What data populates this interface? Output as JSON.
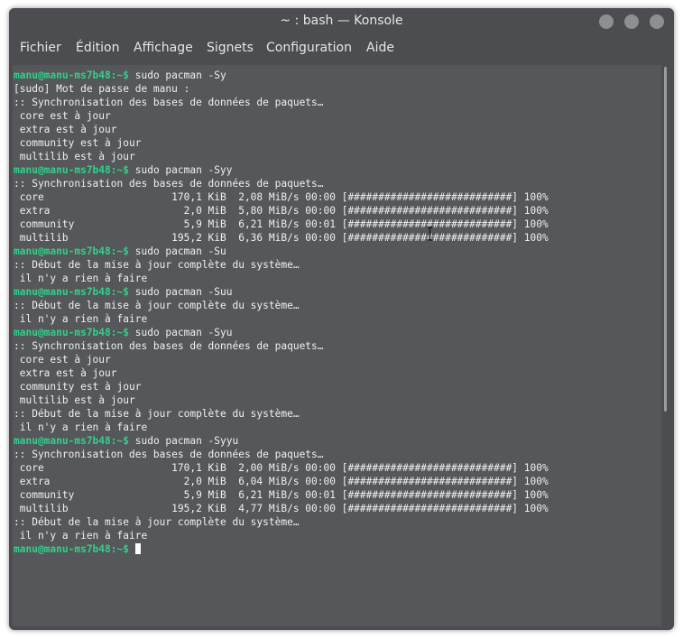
{
  "window": {
    "title": "~ : bash — Konsole",
    "controls": [
      "minimize-icon",
      "maximize-icon",
      "close-icon"
    ]
  },
  "menu": [
    "Fichier",
    "Édition",
    "Affichage",
    "Signets",
    "Configuration",
    "Aide"
  ],
  "terminal": {
    "prompt": "manu@manu-ms7b48",
    "colors": {
      "prompt": "#31d18b",
      "text": "#f0f0f0",
      "background": "#55575a"
    },
    "lines": [
      {
        "p": "manu@manu-ms7b48",
        "s": ":~$",
        "t": " sudo pacman -Sy"
      },
      {
        "t": "[sudo] Mot de passe de manu :"
      },
      {
        "t": ":: Synchronisation des bases de données de paquets…"
      },
      {
        "t": " core est à jour"
      },
      {
        "t": " extra est à jour"
      },
      {
        "t": " community est à jour"
      },
      {
        "t": " multilib est à jour"
      },
      {
        "p": "manu@manu-ms7b48",
        "s": ":~$",
        "t": " sudo pacman -Syy"
      },
      {
        "t": ":: Synchronisation des bases de données de paquets…"
      },
      {
        "t": " core                     170,1 KiB  2,08 MiB/s 00:00 [###########################] 100%"
      },
      {
        "t": " extra                      2,0 MiB  5,80 MiB/s 00:00 [###########################] 100%"
      },
      {
        "t": " community                  5,9 MiB  6,21 MiB/s 00:01 [###########################] 100%"
      },
      {
        "t": " multilib                 195,2 KiB  6,36 MiB/s 00:00 [###########################] 100%"
      },
      {
        "p": "manu@manu-ms7b48",
        "s": ":~$",
        "t": " sudo pacman -Su"
      },
      {
        "t": ":: Début de la mise à jour complète du système…"
      },
      {
        "t": " il n'y a rien à faire"
      },
      {
        "p": "manu@manu-ms7b48",
        "s": ":~$",
        "t": " sudo pacman -Suu"
      },
      {
        "t": ":: Début de la mise à jour complète du système…"
      },
      {
        "t": " il n'y a rien à faire"
      },
      {
        "p": "manu@manu-ms7b48",
        "s": ":~$",
        "t": " sudo pacman -Syu"
      },
      {
        "t": ":: Synchronisation des bases de données de paquets…"
      },
      {
        "t": " core est à jour"
      },
      {
        "t": " extra est à jour"
      },
      {
        "t": " community est à jour"
      },
      {
        "t": " multilib est à jour"
      },
      {
        "t": ":: Début de la mise à jour complète du système…"
      },
      {
        "t": " il n'y a rien à faire"
      },
      {
        "p": "manu@manu-ms7b48",
        "s": ":~$",
        "t": " sudo pacman -Syyu"
      },
      {
        "t": ":: Synchronisation des bases de données de paquets…"
      },
      {
        "t": " core                     170,1 KiB  2,00 MiB/s 00:00 [###########################] 100%"
      },
      {
        "t": " extra                      2,0 MiB  6,04 MiB/s 00:00 [###########################] 100%"
      },
      {
        "t": " community                  5,9 MiB  6,21 MiB/s 00:01 [###########################] 100%"
      },
      {
        "t": " multilib                 195,2 KiB  4,77 MiB/s 00:00 [###########################] 100%"
      },
      {
        "t": ":: Début de la mise à jour complète du système…"
      },
      {
        "t": " il n'y a rien à faire"
      },
      {
        "p": "manu@manu-ms7b48",
        "s": ":~$",
        "t": " ",
        "cursor": true
      }
    ]
  }
}
